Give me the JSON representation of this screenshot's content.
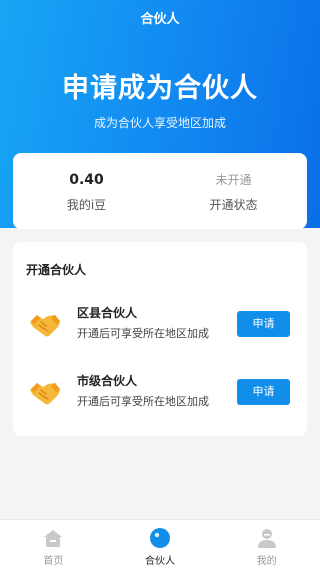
{
  "nav": {
    "title": "合伙人"
  },
  "hero": {
    "title": "申请成为合伙人",
    "subtitle": "成为合伙人享受地区加成"
  },
  "stats": {
    "balance_value": "0.40",
    "balance_label": "我的i豆",
    "status_value": "未开通",
    "status_label": "开通状态"
  },
  "partners": {
    "section_title": "开通合伙人",
    "items": [
      {
        "name": "区县合伙人",
        "desc": "开通后可享受所在地区加成",
        "button": "申请",
        "icon": "handshake-icon"
      },
      {
        "name": "市级合伙人",
        "desc": "开通后可享受所在地区加成",
        "button": "申请",
        "icon": "handshake-icon"
      }
    ]
  },
  "tabbar": {
    "items": [
      {
        "label": "首页",
        "icon": "home-icon"
      },
      {
        "label": "合伙人",
        "icon": "partner-dot-icon",
        "active": true
      },
      {
        "label": "我的",
        "icon": "user-icon"
      }
    ]
  },
  "colors": {
    "accent": "#108eea",
    "hero_start": "#18a6f5",
    "hero_end": "#0a6fe8",
    "icon_gold": "#f6b83a"
  }
}
